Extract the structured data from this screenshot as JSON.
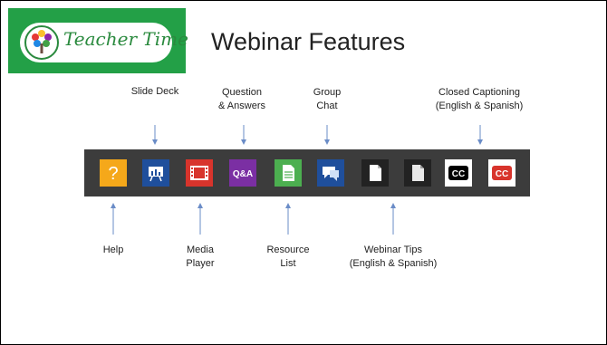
{
  "slide": {
    "logo_text": "Teacher Time",
    "title": "Webinar Features"
  },
  "labels_top": {
    "slide_deck": "Slide Deck",
    "qa": "Question\n& Answers",
    "chat": "Group\nChat",
    "cc": "Closed Captioning\n(English & Spanish)"
  },
  "labels_bottom": {
    "help": "Help",
    "media": "Media\nPlayer",
    "resource": "Resource\nList",
    "tips": "Webinar Tips\n(English & Spanish)"
  },
  "toolbar": {
    "help_glyph": "?",
    "qa_text": "Q&A",
    "cc_text": "CC",
    "cc_spanish_text": "CC"
  },
  "colors": {
    "brand_green": "#23a047",
    "toolbar_bg": "#3c3c3c",
    "help": "#f5a81a",
    "slide_deck": "#1f4f9c",
    "media": "#d8342c",
    "qa": "#7b2fa3",
    "resource": "#4caf50",
    "chat": "#1f4f9c",
    "arrow": "#6a8cc7"
  }
}
